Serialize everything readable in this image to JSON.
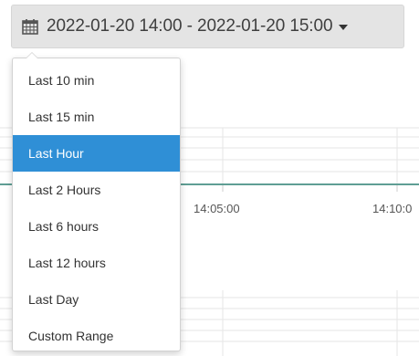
{
  "toolbar": {
    "calendar_icon": "calendar-icon",
    "range_label": "2022-01-20 14:00 - 2022-01-20 15:00",
    "caret_icon": "caret-down-icon"
  },
  "chart": {
    "x_ticks": [
      "14:05:00",
      "14:10:0"
    ],
    "line_color": "#5f9e94",
    "grid_color": "#e6e6e6"
  },
  "dropdown": {
    "selected_index": 2,
    "accent_color": "#2f8fd6",
    "items": [
      {
        "label": "Last 10 min"
      },
      {
        "label": "Last 15 min"
      },
      {
        "label": "Last Hour"
      },
      {
        "label": "Last 2 Hours"
      },
      {
        "label": "Last 6 hours"
      },
      {
        "label": "Last 12 hours"
      },
      {
        "label": "Last Day"
      },
      {
        "label": "Custom Range"
      }
    ]
  }
}
